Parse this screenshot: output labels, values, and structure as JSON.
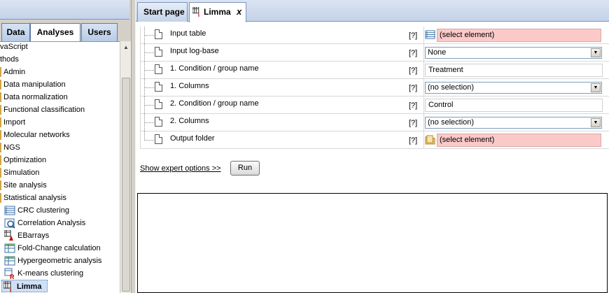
{
  "left_panel": {
    "tabs": [
      "Data",
      "Analyses",
      "Users"
    ],
    "active_tab": "Analyses",
    "tree": [
      {
        "label": "vaScript",
        "icon": "none"
      },
      {
        "label": "thods",
        "icon": "none"
      },
      {
        "label": "Admin",
        "icon": "folder-line"
      },
      {
        "label": "Data manipulation",
        "icon": "folder-line"
      },
      {
        "label": "Data normalization",
        "icon": "folder-line"
      },
      {
        "label": "Functional classification",
        "icon": "folder-line"
      },
      {
        "label": "Import",
        "icon": "folder-line"
      },
      {
        "label": "Molecular networks",
        "icon": "folder-line"
      },
      {
        "label": "NGS",
        "icon": "folder-line"
      },
      {
        "label": "Optimization",
        "icon": "folder-line"
      },
      {
        "label": "Simulation",
        "icon": "folder-line"
      },
      {
        "label": "Site analysis",
        "icon": "folder-line"
      },
      {
        "label": "Statistical analysis",
        "icon": "folder-line"
      },
      {
        "label": "CRC clustering",
        "icon": "table-icon"
      },
      {
        "label": "Correlation Analysis",
        "icon": "correlation-icon"
      },
      {
        "label": "EBarrays",
        "icon": "ebarrays-icon"
      },
      {
        "label": "Fold-Change calculation",
        "icon": "table-green-icon"
      },
      {
        "label": "Hypergeometric analysis",
        "icon": "table-green-icon"
      },
      {
        "label": "K-means clustering",
        "icon": "r-icon"
      },
      {
        "label": "Limma",
        "icon": "limma-icon",
        "selected": true
      }
    ]
  },
  "document_tabs": [
    {
      "label": "Start page",
      "active": false
    },
    {
      "label": "Limma",
      "active": true,
      "close": "x"
    }
  ],
  "form": {
    "help_label": "[?]",
    "rows": [
      {
        "label": "Input table",
        "kind": "element",
        "value": "(select element)",
        "icon": "table-icon"
      },
      {
        "label": "Input log-base",
        "kind": "combo",
        "value": "None"
      },
      {
        "label": "1. Condition / group name",
        "kind": "text",
        "value": "Treatment"
      },
      {
        "label": "1. Columns",
        "kind": "combo",
        "value": "(no selection)"
      },
      {
        "label": "2. Condition / group name",
        "kind": "text",
        "value": "Control"
      },
      {
        "label": "2. Columns",
        "kind": "combo",
        "value": "(no selection)"
      },
      {
        "label": "Output folder",
        "kind": "element",
        "value": "(select element)",
        "icon": "folder-icon"
      }
    ],
    "expert_link": "Show expert options >>",
    "run_button": "Run"
  },
  "colors": {
    "invalid_field_bg": "#fcc9c9",
    "tab_border": "#7a96bd",
    "selected_bg": "#cfe0f5"
  }
}
